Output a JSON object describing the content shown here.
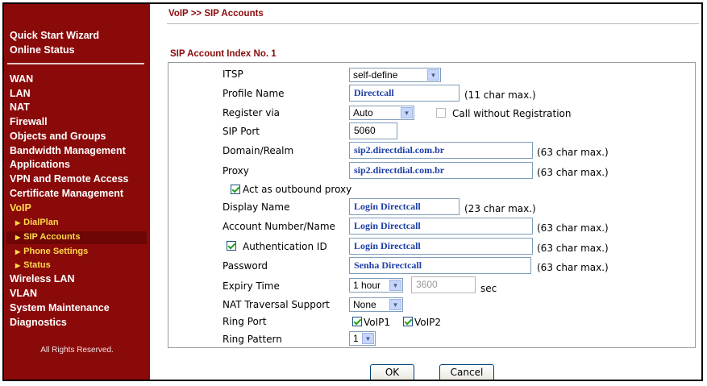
{
  "sidebar": {
    "top_items": [
      "Quick Start Wizard",
      "Online Status"
    ],
    "items": [
      "WAN",
      "LAN",
      "NAT",
      "Firewall",
      "Objects and Groups",
      "Bandwidth Management",
      "Applications",
      "VPN and Remote Access",
      "Certificate Management",
      "VoIP"
    ],
    "voip_sub": [
      "DialPlan",
      "SIP Accounts",
      "Phone Settings",
      "Status"
    ],
    "bottom_items": [
      "Wireless LAN",
      "VLAN",
      "System Maintenance",
      "Diagnostics"
    ],
    "footer": "All Rights Reserved.",
    "active_item": "VoIP",
    "active_sub": "SIP Accounts"
  },
  "breadcrumb": "VoIP >> SIP Accounts",
  "section_title": "SIP Account Index No. 1",
  "form": {
    "itsp": {
      "label": "ITSP",
      "value": "self-define"
    },
    "profile_name": {
      "label": "Profile Name",
      "value": "Directcall",
      "note": "(11 char max.)"
    },
    "register_via": {
      "label": "Register via",
      "value": "Auto",
      "checkbox_label": "Call without Registration",
      "checked": false
    },
    "sip_port": {
      "label": "SIP Port",
      "value": "5060"
    },
    "domain": {
      "label": "Domain/Realm",
      "value": "sip2.directdial.com.br",
      "note": "(63 char max.)"
    },
    "proxy": {
      "label": "Proxy",
      "value": "sip2.directdial.com.br",
      "note": "(63 char max.)"
    },
    "outbound_proxy": {
      "label": "Act as outbound proxy",
      "checked": true
    },
    "display_name": {
      "label": "Display Name",
      "value": "Login Directcall",
      "note": "(23 char max.)"
    },
    "account_number": {
      "label": "Account Number/Name",
      "value": "Login Directcall",
      "note": "(63 char max.)"
    },
    "auth_id": {
      "label": "Authentication ID",
      "value": "Login Directcall",
      "note": "(63 char max.)",
      "checked": true
    },
    "password": {
      "label": "Password",
      "value": "Senha Directcall",
      "note": "(63 char max.)"
    },
    "expiry": {
      "label": "Expiry Time",
      "value": "1 hour",
      "seconds": "3600",
      "unit": "sec"
    },
    "nat": {
      "label": "NAT Traversal Support",
      "value": "None"
    },
    "ring_port": {
      "label": "Ring Port",
      "ports": [
        {
          "label": "VoIP1",
          "checked": true
        },
        {
          "label": "VoIP2",
          "checked": true
        }
      ]
    },
    "ring_pattern": {
      "label": "Ring Pattern",
      "value": "1"
    }
  },
  "buttons": {
    "ok": "OK",
    "cancel": "Cancel"
  },
  "colors": {
    "sidebar_bg": "#8a0a0a",
    "accent_yellow": "#ffd84a",
    "input_text_blue": "#1e3fa6",
    "title_red": "#8a0a0a"
  }
}
